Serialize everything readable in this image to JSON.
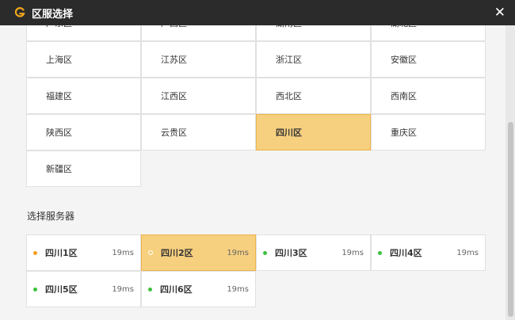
{
  "window": {
    "title": "区服选择",
    "close_glyph": "✕"
  },
  "colors": {
    "accent": "#f7d07f",
    "green": "#3cc13c",
    "orange": "#f0a020",
    "title_bar": "#2b2b2b"
  },
  "regions": [
    "广东区",
    "广西区",
    "湖南区",
    "湖北区",
    "上海区",
    "江苏区",
    "浙江区",
    "安徽区",
    "福建区",
    "江西区",
    "西北区",
    "西南区",
    "陕西区",
    "云贵区",
    "四川区",
    "重庆区",
    "新疆区"
  ],
  "selected_region": "四川区",
  "server_section_label": "选择服务器",
  "servers": [
    {
      "name": "四川1区",
      "ping": "19ms",
      "status": "orange"
    },
    {
      "name": "四川2区",
      "ping": "19ms",
      "status": "selected"
    },
    {
      "name": "四川3区",
      "ping": "19ms",
      "status": "green"
    },
    {
      "name": "四川4区",
      "ping": "19ms",
      "status": "green"
    },
    {
      "name": "四川5区",
      "ping": "19ms",
      "status": "green"
    },
    {
      "name": "四川6区",
      "ping": "19ms",
      "status": "green"
    }
  ],
  "selected_server": "四川2区"
}
